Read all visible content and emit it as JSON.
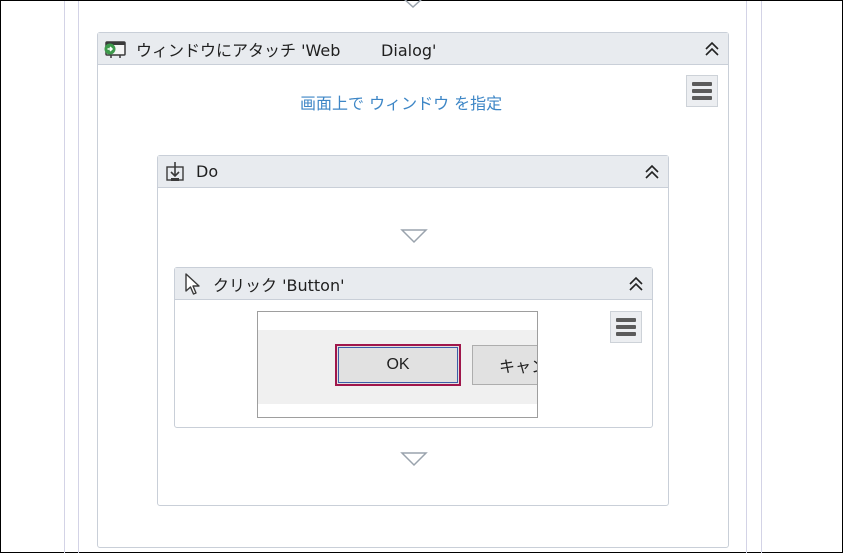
{
  "attach_window": {
    "title": "ウィンドウにアタッチ 'Web        Dialog'",
    "icon": "attach-window-icon",
    "collapse_icon": "double-chevron-up-icon",
    "indicate_link": "画面上で ウィンドウ を指定",
    "menu_icon": "hamburger-menu-icon"
  },
  "do_sequence": {
    "title": "Do",
    "icon": "do-sequence-icon",
    "collapse_icon": "double-chevron-up-icon"
  },
  "click_activity": {
    "title": "クリック 'Button'",
    "icon": "mouse-pointer-icon",
    "collapse_icon": "double-chevron-up-icon",
    "menu_icon": "hamburger-menu-icon",
    "preview": {
      "ok_label": "OK",
      "cancel_label": "キャン"
    }
  },
  "connector_icon": "drop-arrow-icon",
  "colors": {
    "header_bg": "#e8ebef",
    "border": "#c9cfd8",
    "link": "#3d86c6",
    "selection": "#a0174b"
  }
}
